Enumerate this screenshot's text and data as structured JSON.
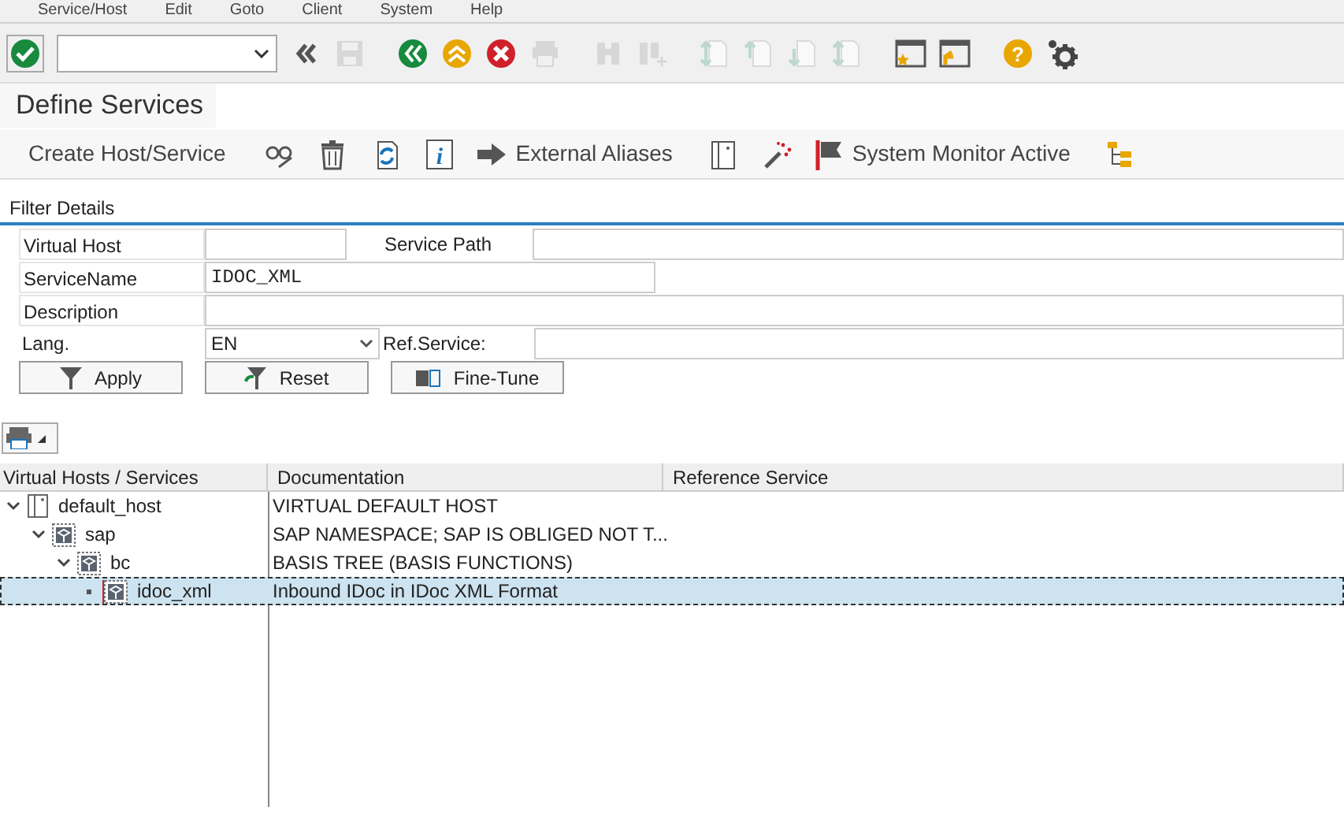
{
  "menu": [
    "Service/Host",
    "Edit",
    "Goto",
    "Client",
    "System",
    "Help"
  ],
  "toolbar": [
    {
      "kind": "enter",
      "disabled": false
    },
    {
      "kind": "command",
      "disabled": false
    },
    {
      "kind": "back-double",
      "disabled": false
    },
    {
      "kind": "save",
      "disabled": true
    },
    {
      "kind": "back",
      "disabled": false
    },
    {
      "kind": "exit",
      "disabled": false
    },
    {
      "kind": "cancel",
      "disabled": false
    },
    {
      "kind": "print",
      "disabled": true
    },
    {
      "kind": "find",
      "disabled": true
    },
    {
      "kind": "find-next",
      "disabled": true
    },
    {
      "kind": "first-page",
      "disabled": true
    },
    {
      "kind": "prev-page",
      "disabled": true
    },
    {
      "kind": "next-page",
      "disabled": true
    },
    {
      "kind": "last-page",
      "disabled": true
    },
    {
      "kind": "new-session",
      "disabled": false
    },
    {
      "kind": "shortcut",
      "disabled": false
    },
    {
      "kind": "help",
      "disabled": false,
      "glyph": "?"
    },
    {
      "kind": "settings",
      "disabled": false
    }
  ],
  "title": "Define Services",
  "app_toolbar": [
    {
      "kind": "text",
      "label": "Create Host/Service"
    },
    {
      "kind": "icon-glasses"
    },
    {
      "kind": "icon-trash"
    },
    {
      "kind": "icon-refresh"
    },
    {
      "kind": "icon-info",
      "glyph": "i"
    },
    {
      "kind": "arrow",
      "label": "External Aliases"
    },
    {
      "kind": "icon-doc"
    },
    {
      "kind": "icon-wand"
    },
    {
      "kind": "flag",
      "label": "System Monitor Active"
    },
    {
      "kind": "icon-hierarchy"
    }
  ],
  "filter": {
    "title": "Filter Details",
    "virtual_host": {
      "label": "Virtual Host"
    },
    "service_path": {
      "label": "Service Path"
    },
    "service_name": {
      "label": "ServiceName",
      "value": "IDOC_XML"
    },
    "description": {
      "label": "Description"
    },
    "lang": {
      "label": "Lang.",
      "value": "EN"
    },
    "ref_service": {
      "label": "Ref.Service:"
    },
    "buttons": [
      {
        "kind": "apply",
        "label": "Apply"
      },
      {
        "kind": "reset",
        "label": "Reset"
      },
      {
        "kind": "fine-tune",
        "label": "Fine-Tune"
      }
    ]
  },
  "tree": {
    "columns": [
      "Virtual Hosts / Services",
      "Documentation",
      "Reference Service"
    ],
    "nodes": [
      {
        "kind": "host",
        "name": "default_host",
        "documentation": "VIRTUAL DEFAULT HOST",
        "expanded": true,
        "selected": false,
        "children": [
          {
            "kind": "service",
            "name": "sap",
            "documentation": "SAP NAMESPACE; SAP IS OBLIGED NOT T...",
            "expanded": true,
            "selected": false,
            "children": [
              {
                "kind": "service",
                "name": "bc",
                "documentation": "BASIS TREE (BASIS FUNCTIONS)",
                "expanded": true,
                "selected": false,
                "children": [
                  {
                    "kind": "service",
                    "name": "idoc_xml",
                    "documentation": "Inbound IDoc in IDoc XML Format",
                    "selected": true
                  }
                ]
              }
            ]
          }
        ]
      }
    ]
  }
}
